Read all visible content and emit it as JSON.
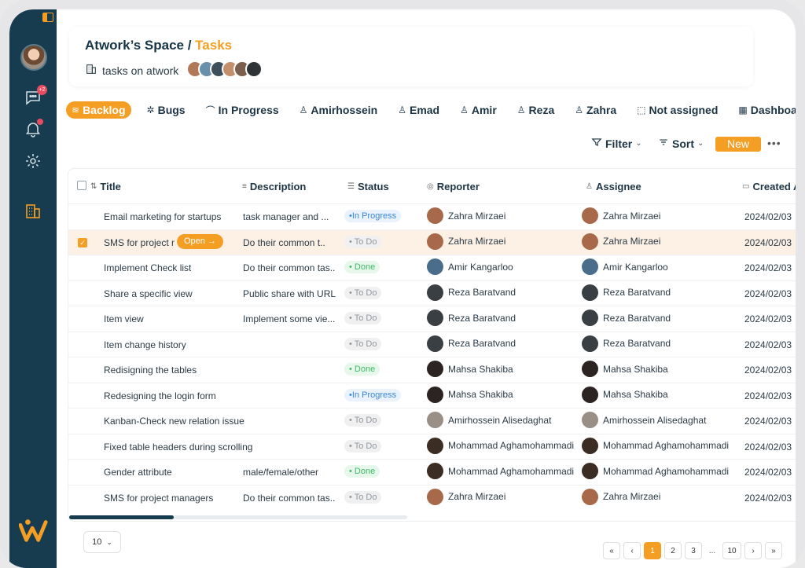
{
  "header": {
    "space": "Atwork’s Space",
    "separator": " / ",
    "section": "Tasks",
    "subtitle": "tasks on atwork",
    "member_colors": [
      "#b07858",
      "#6a8fa8",
      "#3d4f5a",
      "#c48f6a",
      "#7b5e4d",
      "#2f3336"
    ]
  },
  "sidebar": {
    "chat_badge": "+2",
    "icons": [
      "chat-icon",
      "bell-icon",
      "gear-icon",
      "building-icon"
    ],
    "logo_color": "#f59e24"
  },
  "tabs": [
    {
      "label": "Backlog",
      "icon": "≋",
      "active": true
    },
    {
      "label": "Bugs",
      "icon": "✲"
    },
    {
      "label": "In Progress",
      "icon": "⌒"
    },
    {
      "label": "Amirhossein",
      "icon": "♙"
    },
    {
      "label": "Emad",
      "icon": "♙"
    },
    {
      "label": "Amir",
      "icon": "♙"
    },
    {
      "label": "Reza",
      "icon": "♙"
    },
    {
      "label": "Zahra",
      "icon": "♙"
    },
    {
      "label": "Not assigned",
      "icon": "⬚"
    },
    {
      "label": "Dashboard",
      "icon": "▦"
    }
  ],
  "toolbar": {
    "filter": "Filter",
    "sort": "Sort",
    "new": "New",
    "more": "•••"
  },
  "table": {
    "columns": {
      "title": "Title",
      "description": "Description",
      "status": "Status",
      "reporter": "Reporter",
      "assignee": "Assignee",
      "created": "Created At"
    },
    "open_label": "Open →",
    "rows": [
      {
        "title": "Email marketing for startups",
        "description": "task manager and ...",
        "status": "In Progress",
        "reporter": "Zahra Mirzaei",
        "assignee": "Zahra Mirzaei",
        "created": "2024/02/03"
      },
      {
        "title": "SMS for project managers",
        "description": "Do their common t..",
        "status": "To Do",
        "reporter": "Zahra Mirzaei",
        "assignee": "Zahra Mirzaei",
        "created": "2024/02/03",
        "selected": true
      },
      {
        "title": "Implement Check list",
        "description": "Do their common tas..",
        "status": "Done",
        "reporter": "Amir Kangarloo",
        "assignee": "Amir Kangarloo",
        "created": "2024/02/03"
      },
      {
        "title": "Share a specific view",
        "description": "Public share with URL",
        "status": "To Do",
        "reporter": "Reza Baratvand",
        "assignee": "Reza Baratvand",
        "created": "2024/02/03"
      },
      {
        "title": "Item view",
        "description": "Implement some vie...",
        "status": "To Do",
        "reporter": "Reza Baratvand",
        "assignee": "Reza Baratvand",
        "created": "2024/02/03"
      },
      {
        "title": "Item change history",
        "description": "",
        "status": "To Do",
        "reporter": "Reza Baratvand",
        "assignee": "Reza Baratvand",
        "created": "2024/02/03"
      },
      {
        "title": "Redisigning the tables",
        "description": "",
        "status": "Done",
        "reporter": "Mahsa Shakiba",
        "assignee": "Mahsa Shakiba",
        "created": "2024/02/03"
      },
      {
        "title": "Redesigning the login form",
        "description": "",
        "status": "In Progress",
        "reporter": "Mahsa Shakiba",
        "assignee": "Mahsa Shakiba",
        "created": "2024/02/03"
      },
      {
        "title": "Kanban-Check new relation issue",
        "description": "",
        "status": "To Do",
        "reporter": "Amirhossein Alisedaghat",
        "assignee": "Amirhossein Alisedaghat",
        "created": "2024/02/03"
      },
      {
        "title": "Fixed table headers during scrolling",
        "description": "",
        "status": "To Do",
        "reporter": "Mohammad Aghamohammadi",
        "assignee": "Mohammad Aghamohammadi",
        "created": "2024/02/03"
      },
      {
        "title": "Gender attribute",
        "description": "male/female/other",
        "status": "Done",
        "reporter": "Mohammad Aghamohammadi",
        "assignee": "Mohammad Aghamohammadi",
        "created": "2024/02/03"
      },
      {
        "title": "SMS for project managers",
        "description": "Do their common tas..",
        "status": "To Do",
        "reporter": "Zahra Mirzaei",
        "assignee": "Zahra Mirzaei",
        "created": "2024/02/03"
      }
    ]
  },
  "avatar_colors": {
    "Zahra Mirzaei": "#a8684a",
    "Amir Kangarloo": "#4b6d8c",
    "Reza Baratvand": "#3a3f44",
    "Mahsa Shakiba": "#2c2422",
    "Amirhossein Alisedaghat": "#9a8f86",
    "Mohammad Aghamohammadi": "#3b2c24"
  },
  "pagination": {
    "page_size": "10",
    "first": "«",
    "prev": "‹",
    "pages": [
      "1",
      "2",
      "3"
    ],
    "ellipsis": "...",
    "last_page": "10",
    "next": "›",
    "last": "»"
  }
}
